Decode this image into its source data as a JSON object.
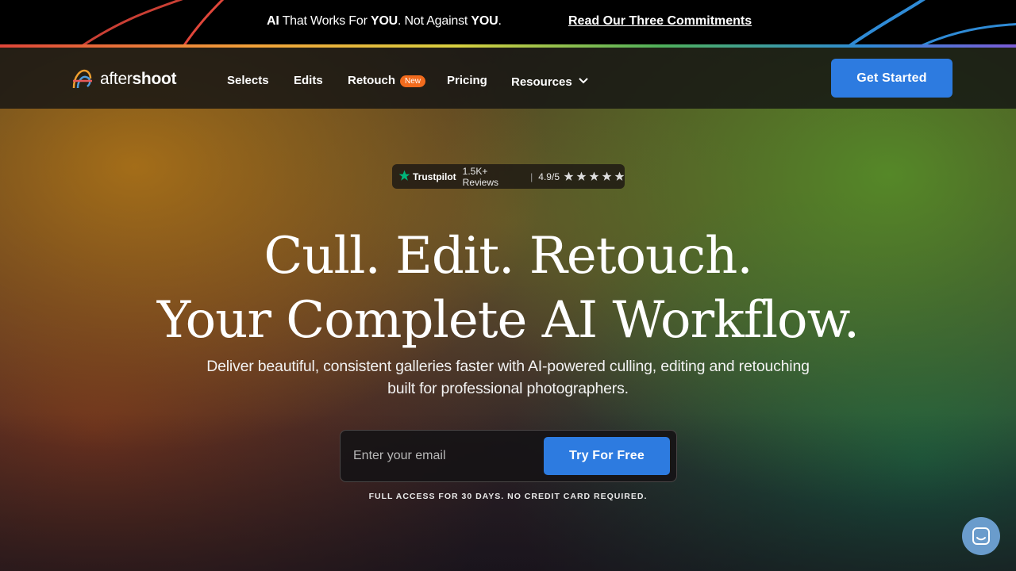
{
  "announcement": {
    "part1_bold": "AI",
    "part2": " That Works For ",
    "part3_bold": "YOU",
    "part4": ". Not Against ",
    "part5_bold": "YOU",
    "part6": ".",
    "link": "Read Our Three Commitments"
  },
  "nav": {
    "logo_light": "after",
    "logo_bold": "shoot",
    "items": [
      {
        "label": "Selects"
      },
      {
        "label": "Edits"
      },
      {
        "label": "Retouch",
        "badge": "New"
      },
      {
        "label": "Pricing"
      },
      {
        "label": "Resources",
        "icon": "chevron-down-icon"
      }
    ],
    "cta": "Get Started"
  },
  "trustpilot": {
    "name": "Trustpilot",
    "reviews": "1.5K+ Reviews",
    "separator": "|",
    "rating": "4.9/5",
    "stars": 5
  },
  "hero": {
    "headline_line1": "Cull. Edit. Retouch.",
    "headline_line2": "Your Complete AI Workflow.",
    "subtext_line1": "Deliver beautiful, consistent galleries faster with AI-powered culling, editing and retouching",
    "subtext_line2": "built for professional photographers."
  },
  "signup": {
    "email_placeholder": "Enter your email",
    "email_value": "",
    "button": "Try For Free",
    "note": "FULL ACCESS FOR 30 DAYS. NO CREDIT CARD REQUIRED."
  },
  "colors": {
    "accent_blue": "#2d7be0",
    "badge_orange": "#f26b1d",
    "trustpilot_green": "#00b67a",
    "chat_blue": "#6a9ccc"
  },
  "chat": {
    "icon": "chat-icon"
  }
}
